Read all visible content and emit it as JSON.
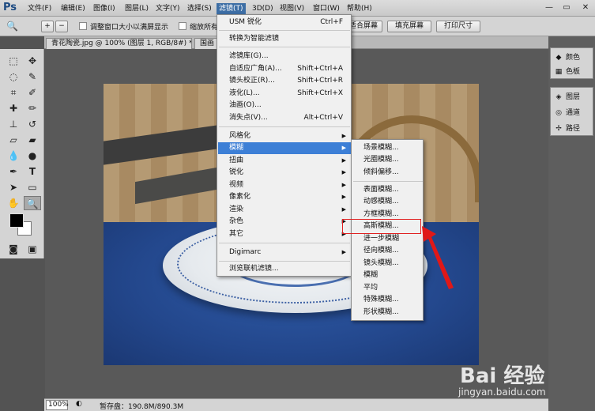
{
  "app": {
    "logo": "Ps",
    "menu": [
      "文件(F)",
      "编辑(E)",
      "图像(I)",
      "图层(L)",
      "文字(Y)",
      "选择(S)",
      "滤镜(T)",
      "3D(D)",
      "视图(V)",
      "窗口(W)",
      "帮助(H)"
    ],
    "active_menu": "滤镜(T)",
    "window_controls": {
      "minimize": "—",
      "restore": "▭",
      "close": "✕"
    }
  },
  "options_bar": {
    "checkbox1_label": "调整窗口大小以满屏显示",
    "checkbox2_label": "缩放所有",
    "btn_fit_screen": "适合屏幕",
    "btn_fill_screen": "填充屏幕",
    "btn_print_size": "打印尺寸"
  },
  "document": {
    "tab1": "青花陶瓷.jpg @ 100% (图层 1, RGB/8#) *",
    "tab2": "国画"
  },
  "filter_menu": {
    "items": [
      {
        "label": "USM 锐化",
        "shortcut": "Ctrl+F"
      },
      {
        "label": "转换为智能滤镜",
        "shortcut": ""
      },
      {
        "label": "滤镜库(G)...",
        "shortcut": ""
      },
      {
        "label": "自适应广角(A)...",
        "shortcut": "Shift+Ctrl+A"
      },
      {
        "label": "镜头校正(R)...",
        "shortcut": "Shift+Ctrl+R"
      },
      {
        "label": "液化(L)...",
        "shortcut": "Shift+Ctrl+X"
      },
      {
        "label": "油画(O)...",
        "shortcut": ""
      },
      {
        "label": "消失点(V)...",
        "shortcut": "Alt+Ctrl+V"
      },
      {
        "label": "风格化",
        "shortcut": ""
      },
      {
        "label": "模糊",
        "shortcut": ""
      },
      {
        "label": "扭曲",
        "shortcut": ""
      },
      {
        "label": "锐化",
        "shortcut": ""
      },
      {
        "label": "视频",
        "shortcut": ""
      },
      {
        "label": "像素化",
        "shortcut": ""
      },
      {
        "label": "渲染",
        "shortcut": ""
      },
      {
        "label": "杂色",
        "shortcut": ""
      },
      {
        "label": "其它",
        "shortcut": ""
      },
      {
        "label": "Digimarc",
        "shortcut": ""
      },
      {
        "label": "浏览联机滤镜...",
        "shortcut": ""
      }
    ]
  },
  "blur_submenu": {
    "items": [
      "场景模糊...",
      "光圈模糊...",
      "倾斜偏移...",
      "表面模糊...",
      "动感模糊...",
      "方框模糊...",
      "高斯模糊...",
      "进一步模糊",
      "径向模糊...",
      "镜头模糊...",
      "模糊",
      "平均",
      "特殊模糊...",
      "形状模糊..."
    ],
    "highlighted": "高斯模糊..."
  },
  "right_panel": {
    "items": [
      "颜色",
      "色板",
      "图层",
      "通道",
      "路径"
    ]
  },
  "status": {
    "zoom": "100%",
    "scratch": "暂存盘：190.8M/890.3M"
  },
  "watermark": {
    "logo": "Bai 经验",
    "url": "jingyan.baidu.com"
  }
}
